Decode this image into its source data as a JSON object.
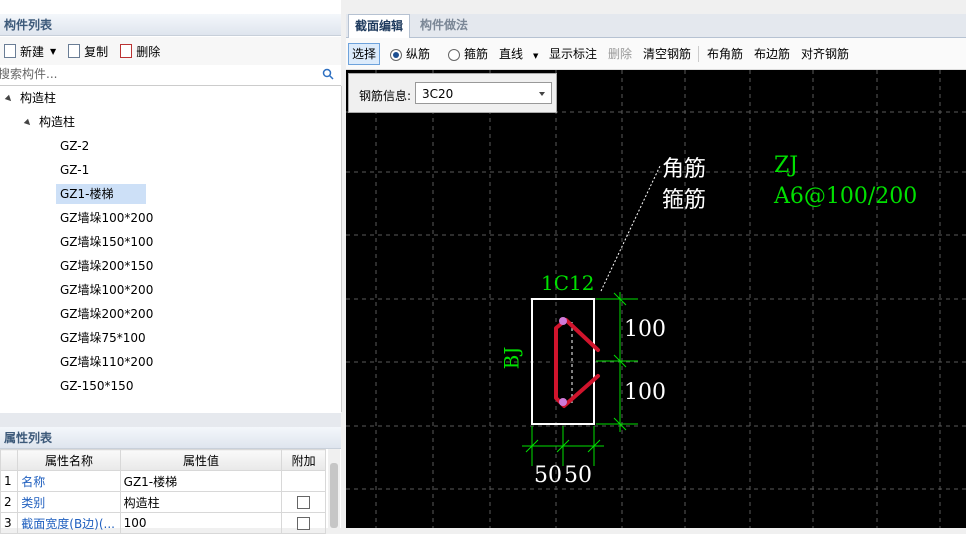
{
  "component_list": {
    "title": "构件列表",
    "toolbar": {
      "new_label": "新建",
      "copy_label": "复制",
      "delete_label": "删除"
    },
    "search_placeholder": "搜索构件...",
    "tree": {
      "root": "构造柱",
      "group": "构造柱",
      "items": [
        "GZ-2",
        "GZ-1",
        "GZ1-楼梯",
        "GZ墙垛100*200",
        "GZ墙垛150*100",
        "GZ墙垛200*150",
        "GZ墙垛100*200",
        "GZ墙垛200*200",
        "GZ墙垛75*100",
        "GZ墙垛110*200",
        "GZ-150*150"
      ],
      "selected_index": 2
    }
  },
  "property_list": {
    "title": "属性列表",
    "headers": [
      "属性名称",
      "属性值",
      "附加"
    ],
    "rows": [
      {
        "num": "1",
        "name": "名称",
        "value": "GZ1-楼梯"
      },
      {
        "num": "2",
        "name": "类别",
        "value": "构造柱"
      },
      {
        "num": "3",
        "name": "截面宽度(B边)(...",
        "value": "100"
      }
    ]
  },
  "editor": {
    "tabs": [
      "截面编辑",
      "构件做法"
    ],
    "active_tab": 0,
    "toolbar": {
      "select": "选择",
      "longitudinal": "纵筋",
      "stirrup": "箍筋",
      "line": "直线",
      "show_label": "显示标注",
      "delete": "删除",
      "clear": "清空钢筋",
      "corner": "布角筋",
      "edge": "布边筋",
      "align": "对齐钢筋"
    },
    "rebar_info": {
      "label": "钢筋信息:",
      "value": "3C20"
    },
    "drawing": {
      "legend_corner": "角筋",
      "legend_stirrup": "箍筋",
      "corner_value": "ZJ",
      "stirrup_value": "A6@100/200",
      "top_label": "1C12",
      "side_label": "BJ",
      "dim_right_1": "100",
      "dim_right_2": "100",
      "dim_bottom_1": "50",
      "dim_bottom_2": "50"
    },
    "colors": {
      "green": "#00e000",
      "white": "#ffffff",
      "rebar": "#d0142c",
      "grid": "#666666"
    }
  }
}
